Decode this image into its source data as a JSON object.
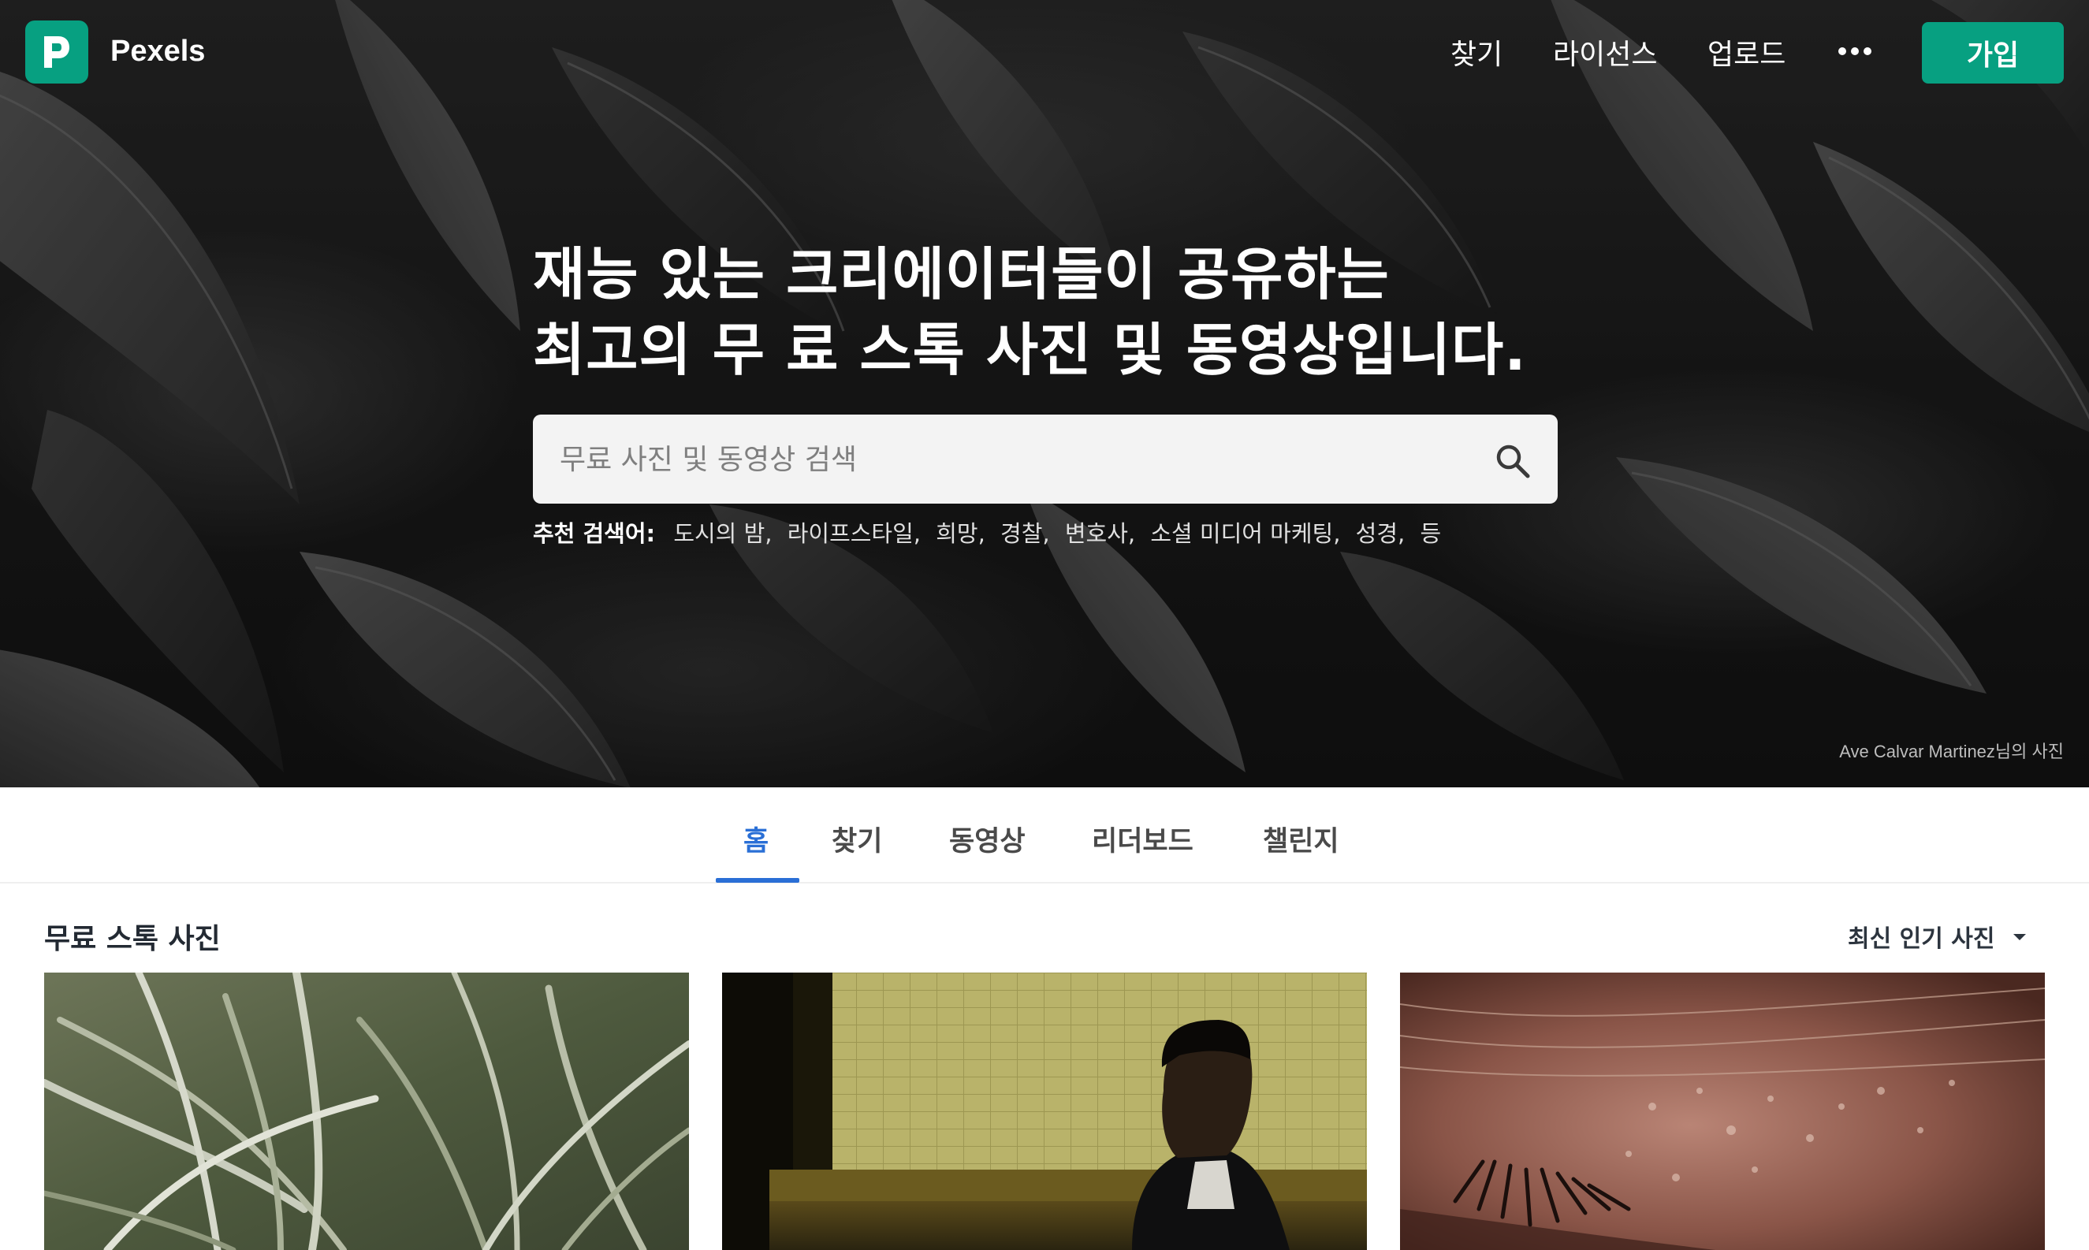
{
  "brand": {
    "name": "Pexels",
    "accent": "#07a081"
  },
  "nav": {
    "links": [
      "찾기",
      "라이선스",
      "업로드"
    ],
    "more_icon": "more-dots-icon",
    "join_label": "가입"
  },
  "hero": {
    "title_line1": "재능 있는 크리에이터들이 공유하는",
    "title_line2": "최고의 무 료 스톡 사진 및 동영상입니다.",
    "search": {
      "placeholder": "무료 사진 및 동영상 검색",
      "value": "",
      "icon": "search-icon"
    },
    "suggest_label": "추천 검색어:",
    "suggestions": [
      "도시의 밤",
      "라이프스타일",
      "희망",
      "경찰",
      "변호사",
      "소셜 미디어 마케팅",
      "성경",
      "등"
    ],
    "credit": "Ave Calvar Martinez님의 사진"
  },
  "tabs": {
    "items": [
      "홈",
      "찾기",
      "동영상",
      "리더보드",
      "챌린지"
    ],
    "active": "홈",
    "active_color": "#2a6fd6"
  },
  "section": {
    "title": "무료 스톡 사진",
    "sort_label": "최신 인기 사진",
    "sort_icon": "caret-down-icon"
  },
  "photos": [
    {
      "subject": "grass"
    },
    {
      "subject": "man in subway"
    },
    {
      "subject": "skin close-up"
    }
  ]
}
